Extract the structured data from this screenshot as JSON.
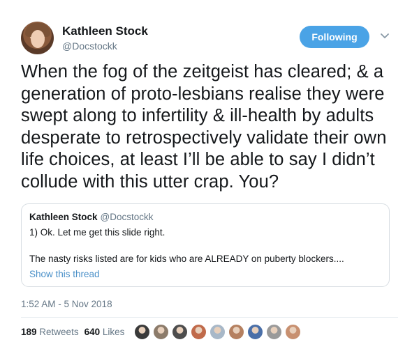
{
  "author": {
    "name": "Kathleen Stock",
    "handle": "@Docstockk",
    "avatar_icon": "profile-photo"
  },
  "follow_button": {
    "label": "Following",
    "color": "#4aa3e6"
  },
  "menu": {
    "icon": "chevron-down-icon"
  },
  "tweet_text": "When the fog of the zeitgeist has cleared; & a generation of proto-lesbians realise they were swept along to infertility & ill-health by adults desperate to retrospectively validate their own life choices, at least I’ll be able to say I didn’t collude with this utter crap. You?",
  "quoted_tweet": {
    "name": "Kathleen Stock",
    "handle": "@Docstockk",
    "line1": "1) Ok. Let me get this slide right.",
    "line2": "The nasty risks listed are for kids who are ALREADY on puberty blockers....",
    "show_thread": "Show this thread"
  },
  "timestamp": "1:52 AM - 5 Nov 2018",
  "stats": {
    "retweets_count": "189",
    "retweets_label": "Retweets",
    "likes_count": "640",
    "likes_label": "Likes"
  },
  "liker_avatars": [
    {
      "color": "#3a3a3a"
    },
    {
      "color": "#8c7b6a"
    },
    {
      "color": "#4d4d4d"
    },
    {
      "color": "#c06a4a"
    },
    {
      "color": "#a8b8c8"
    },
    {
      "color": "#b58060"
    },
    {
      "color": "#4a6fa8"
    },
    {
      "color": "#9a9a9a"
    },
    {
      "color": "#c89070"
    }
  ]
}
